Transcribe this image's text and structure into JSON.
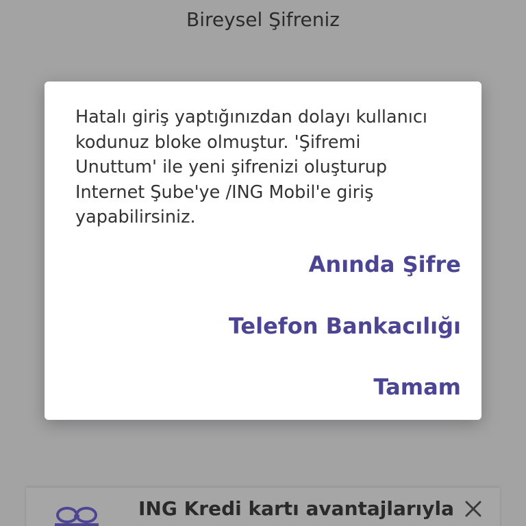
{
  "page": {
    "title": "Bireysel Şifreniz"
  },
  "dialog": {
    "message_lines": [
      "Hatalı giriş yaptığınızdan dolayı kullanıcı",
      "kodunuz bloke olmuştur. 'Şifremi",
      "Unuttum' ile yeni şifrenizi oluşturup",
      "Internet Şube'ye /ING Mobil'e giriş",
      "yapabilirsiniz."
    ],
    "actions": [
      "Anında Şifre",
      "Telefon Bankacılığı",
      "Tamam"
    ]
  },
  "banner": {
    "text": "ING Kredi kartı avantajlarıyla",
    "icon": "gift-icon",
    "close_icon": "close-icon"
  },
  "colors": {
    "backdrop": "#a3a3a4",
    "dialog_background": "#ffffff",
    "action_text": "#4b4593",
    "gift_icon": "#4b4593"
  }
}
